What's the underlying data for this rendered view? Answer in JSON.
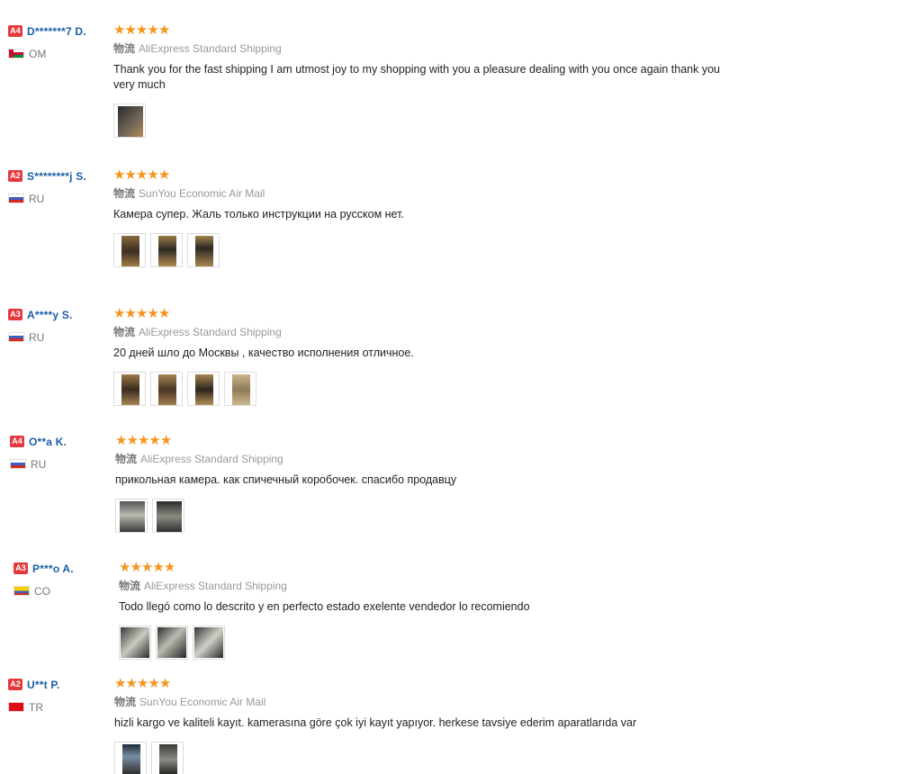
{
  "ship_label": "物流",
  "reviews": [
    {
      "level": "A4",
      "name": "D*******7 D.",
      "country": "OM",
      "shipping": "AliExpress Standard Shipping",
      "text": "Thank you for the fast shipping I am utmost joy to my shopping with you a pleasure dealing with you once again thank you very much",
      "stars": 5,
      "photos": 1
    },
    {
      "level": "A2",
      "name": "S********j S.",
      "country": "RU",
      "shipping": "SunYou Economic Air Mail",
      "text": "Камера супер. Жаль только инструкции на русском нет.",
      "stars": 5,
      "photos": 3
    },
    {
      "level": "A3",
      "name": "A****y S.",
      "country": "RU",
      "shipping": "AliExpress Standard Shipping",
      "text": "20 дней шло до Москвы , качество исполнения отличное.",
      "stars": 5,
      "photos": 4
    },
    {
      "level": "A4",
      "name": "O**a K.",
      "country": "RU",
      "shipping": "AliExpress Standard Shipping",
      "text": "прикольная камера. как спичечный коробочек. спасибо продавцу",
      "stars": 5,
      "photos": 2
    },
    {
      "level": "A3",
      "name": "P***o A.",
      "country": "CO",
      "shipping": "AliExpress Standard Shipping",
      "text": "Todo llegó como lo descrito y en perfecto estado exelente vendedor lo recomiendo",
      "stars": 5,
      "photos": 3
    },
    {
      "level": "A2",
      "name": "U**t P.",
      "country": "TR",
      "shipping": "SunYou Economic Air Mail",
      "text": "hizli kargo ve kaliteli kayıt. kamerasına göre çok iyi kayıt yapıyor. herkese tavsiye ederim aparatlarıda var",
      "stars": 5,
      "photos": 2
    }
  ],
  "star_color": "#f7941d",
  "level_color": "#e4393c",
  "name_color": "#1a5fa8"
}
